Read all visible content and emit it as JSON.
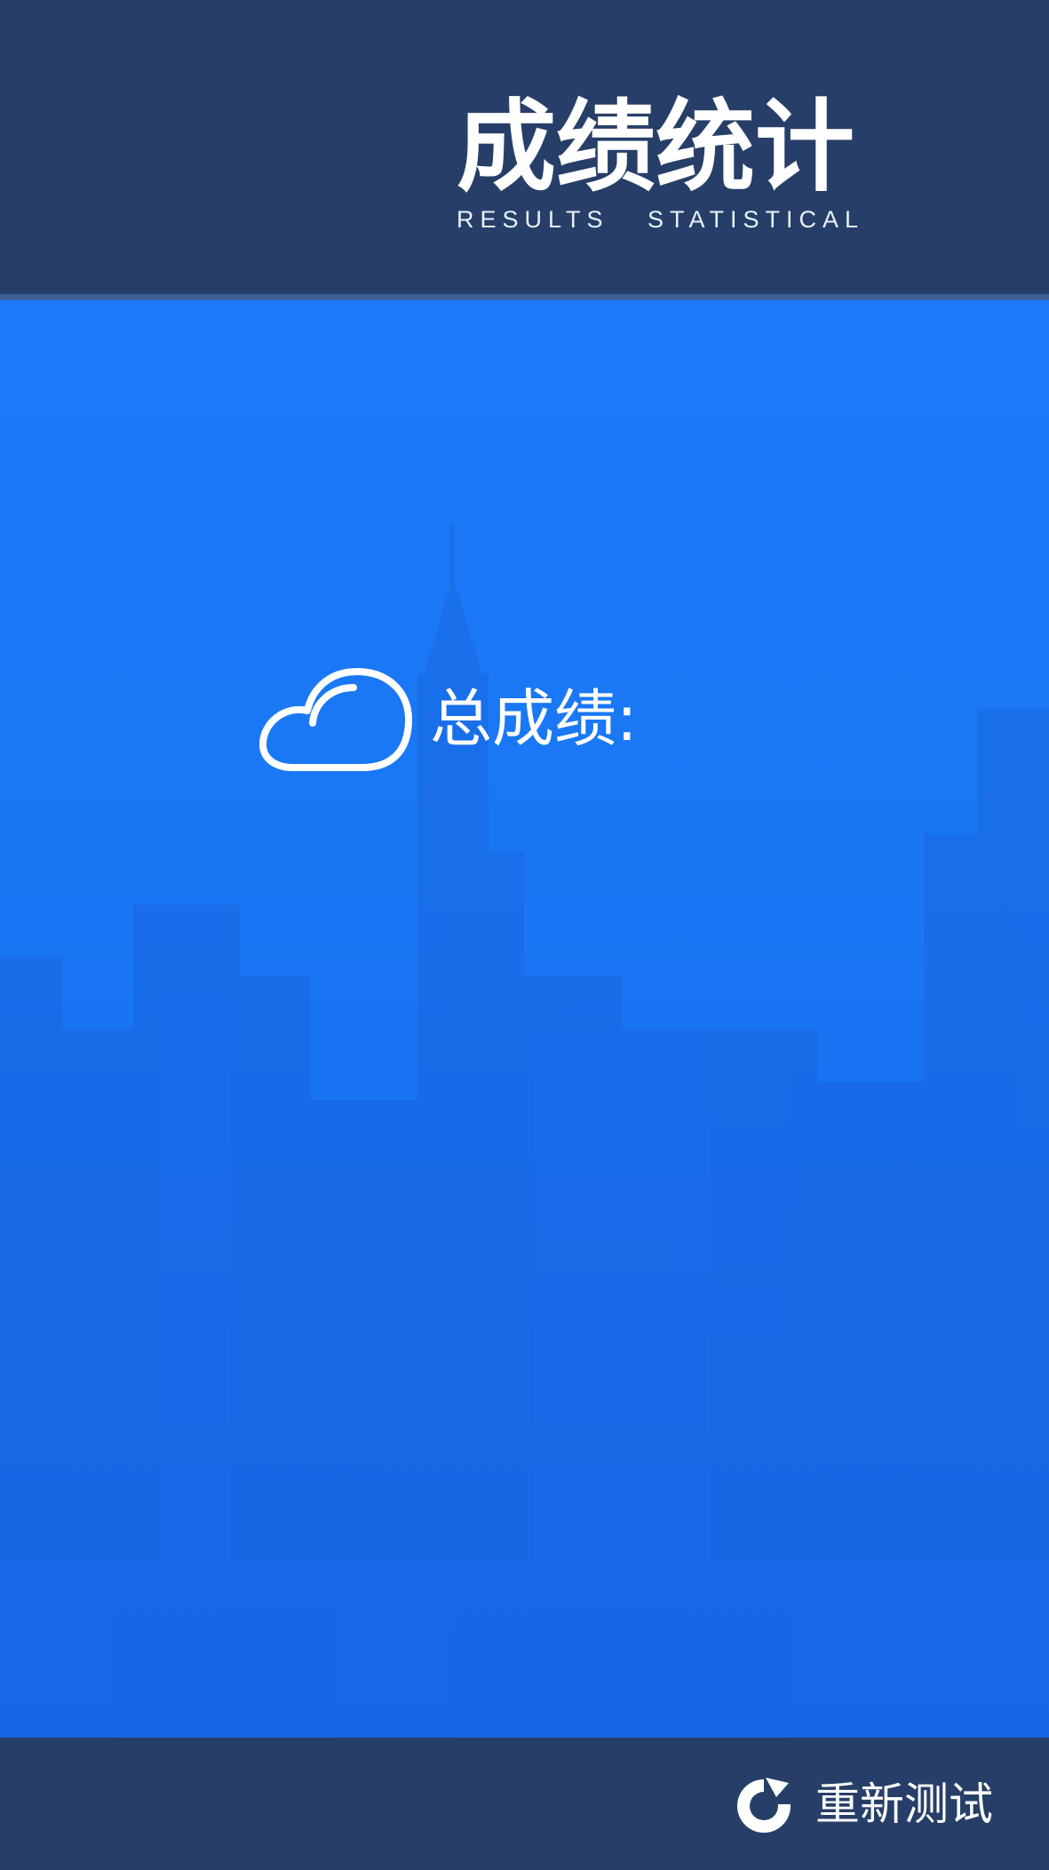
{
  "header": {
    "title": "成绩统计",
    "subtitle": "RESULTS   STATISTICAL"
  },
  "score": {
    "icon": "cloud-icon",
    "label": "总成绩:"
  },
  "footer": {
    "retest_icon": "refresh-icon",
    "retest_label": "重新测试"
  },
  "colors": {
    "header_bg": "#273f68",
    "main_bg": "#1a73f0",
    "text": "#ffffff"
  }
}
